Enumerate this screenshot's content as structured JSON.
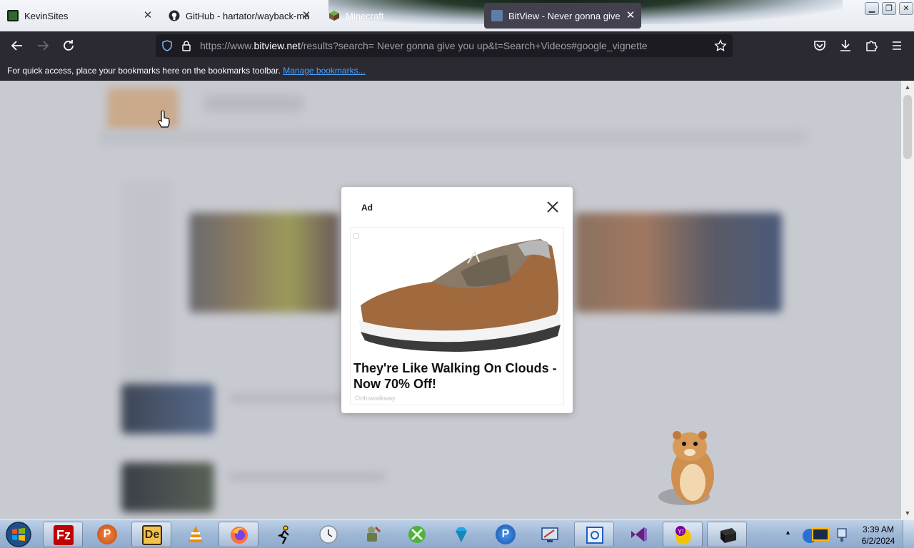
{
  "browser": {
    "tabs": [
      {
        "title": "KevinSites",
        "icon": "kevinsites-favicon",
        "active": false,
        "icon_color": "#2d6b2a"
      },
      {
        "title": "GitHub - hartator/wayback-ma",
        "icon": "github-favicon",
        "active": false,
        "icon_color": "#24292f"
      },
      {
        "title": "Minecraft",
        "icon": "minecraft-favicon",
        "active": false,
        "icon_color": "#5a8a3a"
      },
      {
        "title": "BitView - Never gonna give you",
        "icon": "bitview-favicon",
        "active": true,
        "icon_color": "#5b7fa8"
      }
    ],
    "url": {
      "prefix": "https://www.",
      "domain": "bitview.net",
      "rest": "/results?search= Never gonna give you up&t=Search+Videos#google_vignette"
    },
    "bookmarks_bar": {
      "message": "For quick access, place your bookmarks here on the bookmarks toolbar.",
      "link": "Manage bookmarks..."
    },
    "accent_color": "#45a1ff"
  },
  "ad": {
    "label": "Ad",
    "headline": "They're Like Walking On Clouds - Now 70% Off!",
    "advertiser": "Orthowalkway",
    "image": "brown-slip-on-shoe"
  },
  "taskbar": {
    "apps": [
      {
        "name": "filezilla",
        "icon": "filezilla-icon",
        "color": "#bf0000"
      },
      {
        "name": "pidgin-like",
        "icon": "p-badge-icon",
        "color": "#e36b2a"
      },
      {
        "name": "de-app",
        "icon": "de-icon",
        "color": "#3a2a10"
      },
      {
        "name": "vlc",
        "icon": "vlc-cone-icon",
        "color": "#f08a00"
      },
      {
        "name": "firefox",
        "icon": "firefox-icon",
        "color": "#ff7139"
      },
      {
        "name": "aim",
        "icon": "aim-runner-icon",
        "color": "#f5c400"
      },
      {
        "name": "clock-app",
        "icon": "clock-icon",
        "color": "#dfe3e8"
      },
      {
        "name": "gimp-like",
        "icon": "paint-tools-icon",
        "color": "#7a8a5a"
      },
      {
        "name": "xbox",
        "icon": "xbox-icon",
        "color": "#52b043"
      },
      {
        "name": "diamond-app",
        "icon": "diamond-icon",
        "color": "#22a8e0"
      },
      {
        "name": "p-app",
        "icon": "p-circle-icon",
        "color": "#2a6fd6"
      },
      {
        "name": "remote-app",
        "icon": "remote-desktop-icon",
        "color": "#1b4a8a"
      },
      {
        "name": "hyperv",
        "icon": "settings-window-icon",
        "color": "#1d5fbf"
      },
      {
        "name": "visual-studio",
        "icon": "visual-studio-icon",
        "color": "#68217a"
      },
      {
        "name": "yahoo-messenger",
        "icon": "yahoo-messenger-icon",
        "color": "#7b0099"
      },
      {
        "name": "terminal",
        "icon": "terminal-icon",
        "color": "#111111"
      }
    ],
    "clock": {
      "time": "3:39 AM",
      "date": "6/2/2024"
    }
  }
}
